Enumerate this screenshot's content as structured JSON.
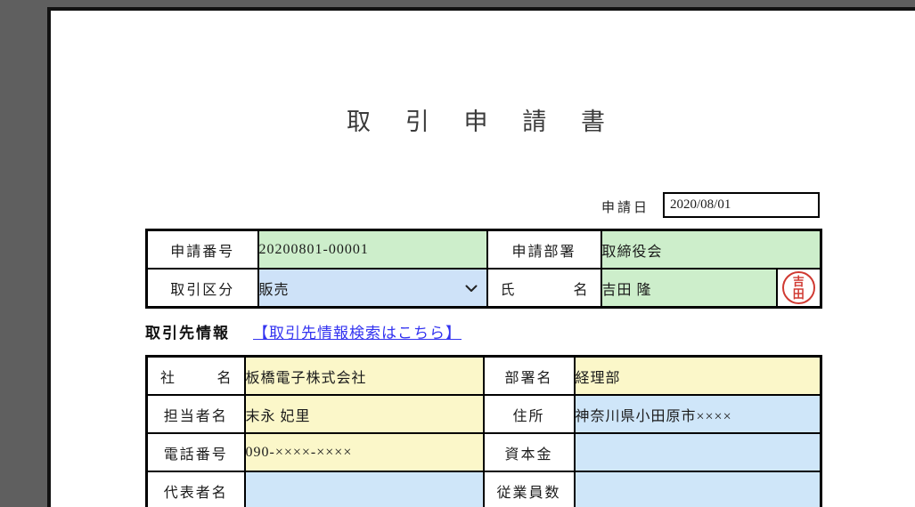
{
  "title": "取 引 申 請 書",
  "application_date": {
    "label": "申請日",
    "value": "2020/08/01"
  },
  "table1": {
    "application_number": {
      "label": "申請番号",
      "value": "20200801-00001"
    },
    "application_department": {
      "label": "申請部署",
      "value": "取締役会"
    },
    "transaction_category": {
      "label": "取引区分",
      "value": "販売"
    },
    "applicant_name": {
      "label": "氏名",
      "value": "吉田 隆"
    },
    "stamp": {
      "line1": "吉",
      "line2": "田"
    }
  },
  "partner_section": {
    "heading": "取引先情報",
    "search_link": "【取引先情報検索はこちら】"
  },
  "table2": {
    "company_name": {
      "label": "社名",
      "value": "板橋電子株式会社"
    },
    "department_name": {
      "label": "部署名",
      "value": "経理部"
    },
    "contact_name": {
      "label": "担当者名",
      "value": "末永 妃里"
    },
    "address": {
      "label": "住所",
      "value": "神奈川県小田原市××××"
    },
    "phone_number": {
      "label": "電話番号",
      "value": "090-××××-××××"
    },
    "capital": {
      "label": "資本金",
      "value": ""
    },
    "representative_name": {
      "label": "代表者名",
      "value": ""
    },
    "employee_count": {
      "label": "従業員数",
      "value": ""
    }
  },
  "colors": {
    "field_green": "#cdeecb",
    "field_blue_select": "#cee2f8",
    "field_lightblue": "#cfe6f9",
    "field_yellow": "#fbf7c9",
    "stamp_red": "#d03a32",
    "link_blue": "#3333f0",
    "preview_background_gray": "#5f5f5f"
  }
}
